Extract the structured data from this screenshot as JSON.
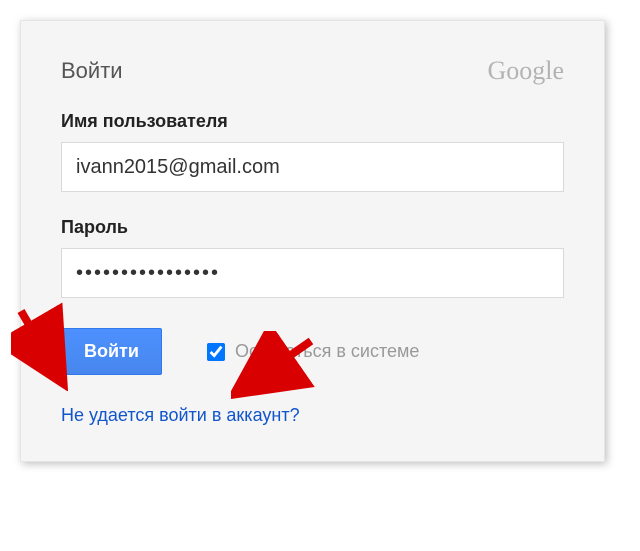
{
  "header": {
    "title": "Войти",
    "brand": "Google"
  },
  "form": {
    "username_label": "Имя пользователя",
    "username_value": "ivann2015@gmail.com",
    "password_label": "Пароль",
    "password_value": "••••••••••••••••",
    "submit_label": "Войти",
    "stay_signed_checked": true,
    "stay_signed_label": "Оставаться в системе"
  },
  "links": {
    "help": "Не удается войти в аккаунт?"
  },
  "annotations": {
    "arrow1_target": "submit-button",
    "arrow2_target": "stay-signed-checkbox",
    "color": "#d80000"
  }
}
